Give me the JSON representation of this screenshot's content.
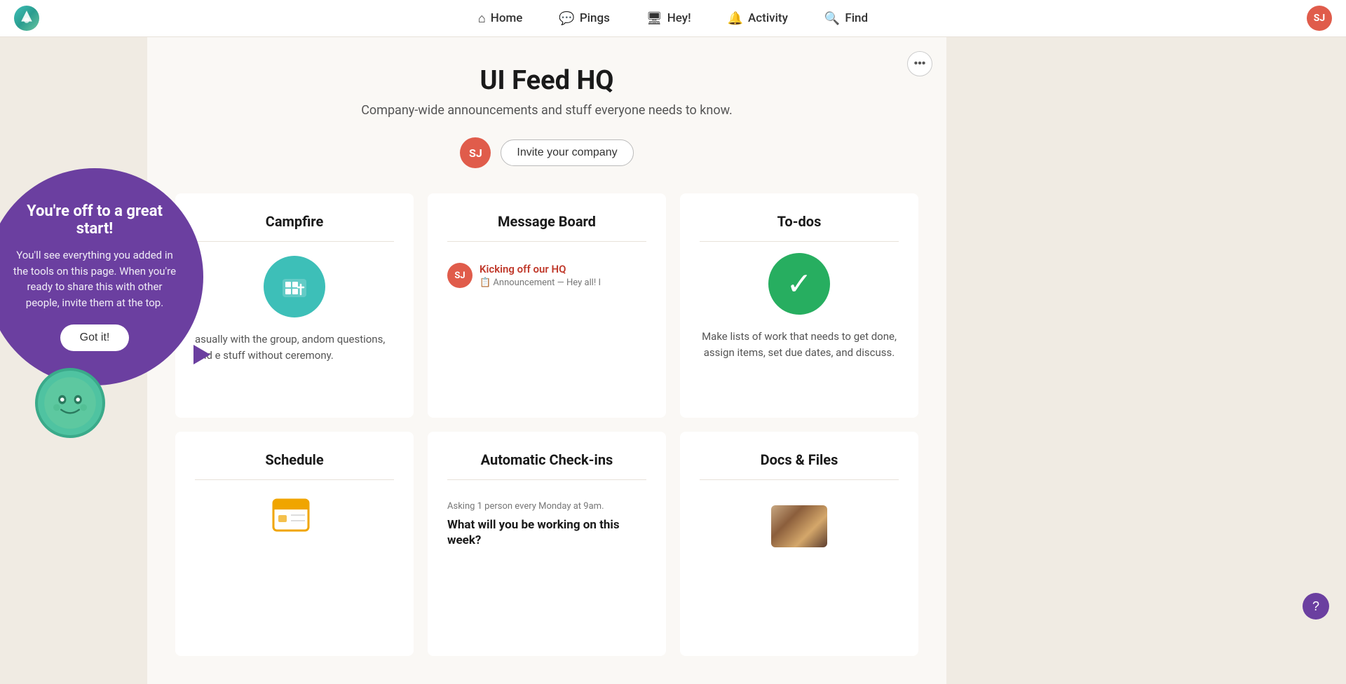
{
  "nav": {
    "home_label": "Home",
    "pings_label": "Pings",
    "hey_label": "Hey!",
    "activity_label": "Activity",
    "find_label": "Find",
    "user_initials": "SJ"
  },
  "header": {
    "title": "UI Feed HQ",
    "subtitle": "Company-wide announcements and stuff everyone needs to know.",
    "more_icon": "•••"
  },
  "invite": {
    "user_initials": "SJ",
    "button_label": "Invite your company"
  },
  "cards": {
    "campfire": {
      "title": "Campfire",
      "description": "asually with the group, andom questions, and e stuff without ceremony."
    },
    "message_board": {
      "title": "Message Board",
      "post_title": "Kicking off our HQ",
      "post_subtitle": "📋 Announcement — Hey all! I",
      "user_initials": "SJ"
    },
    "todos": {
      "title": "To-dos",
      "description": "Make lists of work that needs to get done, assign items, set due dates, and discuss."
    },
    "schedule": {
      "title": "Schedule"
    },
    "checkins": {
      "title": "Automatic Check-ins",
      "asking_label": "Asking 1 person every Monday at 9am.",
      "question": "What will you be working on this week?"
    },
    "docs": {
      "title": "Docs & Files"
    }
  },
  "tooltip": {
    "title": "You're off to a great start!",
    "body": "You'll see everything you added in the tools on this page. When you're ready to share this with other people, invite them at the top.",
    "button_label": "Got it!"
  },
  "help": {
    "icon": "?"
  }
}
